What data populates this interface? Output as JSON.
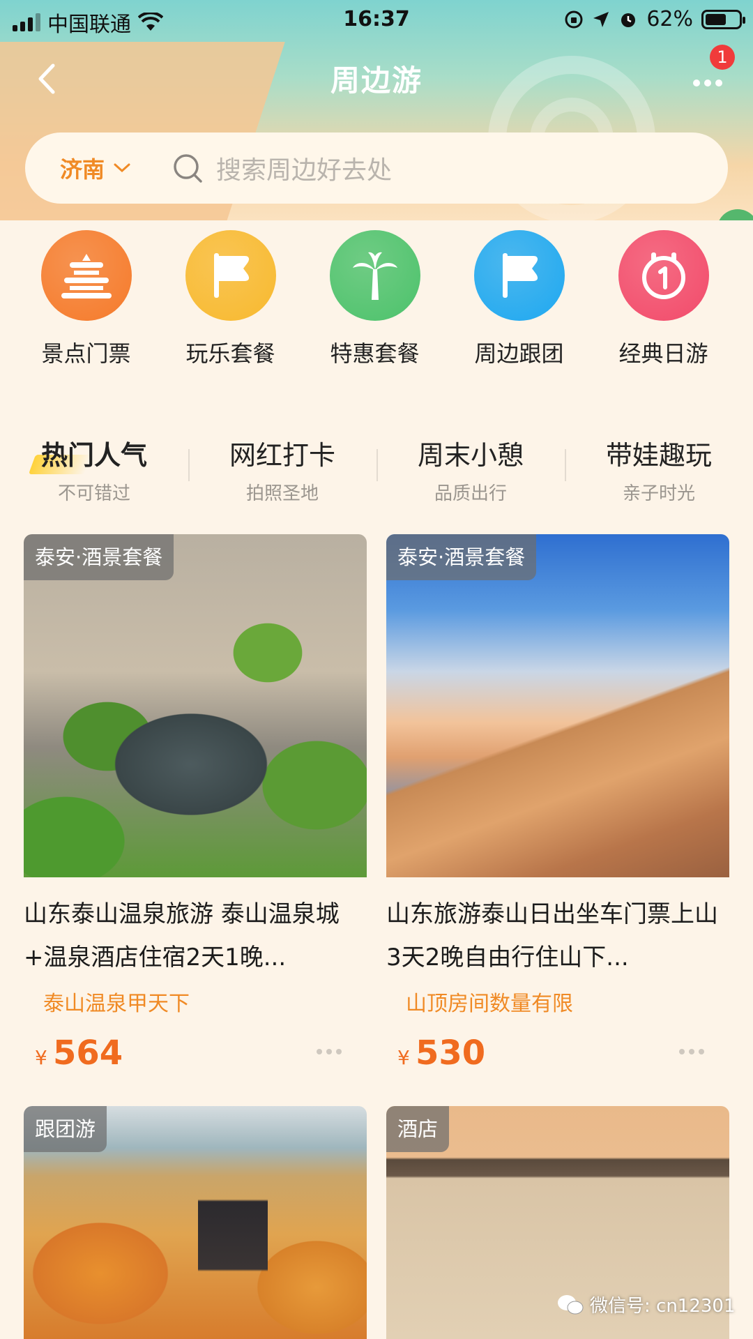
{
  "status_bar": {
    "carrier": "中国联通",
    "time": "16:37",
    "battery": "62%",
    "battery_level": 0.62
  },
  "nav": {
    "title": "周边游",
    "badge_count": "1"
  },
  "search": {
    "city": "济南",
    "placeholder": "搜索周边好去处"
  },
  "categories": [
    {
      "label": "景点门票",
      "icon": "temple-icon",
      "color": "#f57a2a"
    },
    {
      "label": "玩乐套餐",
      "icon": "flag-icon",
      "color": "#f8b92e"
    },
    {
      "label": "特惠套餐",
      "icon": "palm-tree-icon",
      "color": "#4cc26b"
    },
    {
      "label": "周边跟团",
      "icon": "flag-icon",
      "color": "#1ea8f0"
    },
    {
      "label": "经典日游",
      "icon": "calendar-day-icon",
      "color": "#f24a6a"
    }
  ],
  "tabs": [
    {
      "title": "热门人气",
      "subtitle": "不可错过"
    },
    {
      "title": "网红打卡",
      "subtitle": "拍照圣地"
    },
    {
      "title": "周末小憩",
      "subtitle": "品质出行"
    },
    {
      "title": "带娃趣玩",
      "subtitle": "亲子时光"
    }
  ],
  "cards": [
    {
      "tag": "泰安·酒景套餐",
      "title": "山东泰山温泉旅游 泰山温泉城+温泉酒店住宿2天1晚...",
      "promo": "泰山温泉甲天下",
      "currency": "¥",
      "price": "564"
    },
    {
      "tag": "泰安·酒景套餐",
      "title": "山东旅游泰山日出坐车门票上山3天2晚自由行住山下...",
      "promo": "山顶房间数量有限",
      "currency": "¥",
      "price": "530"
    },
    {
      "tag": "跟团游"
    },
    {
      "tag": "酒店"
    }
  ],
  "watermark": "微信号: cn12301"
}
